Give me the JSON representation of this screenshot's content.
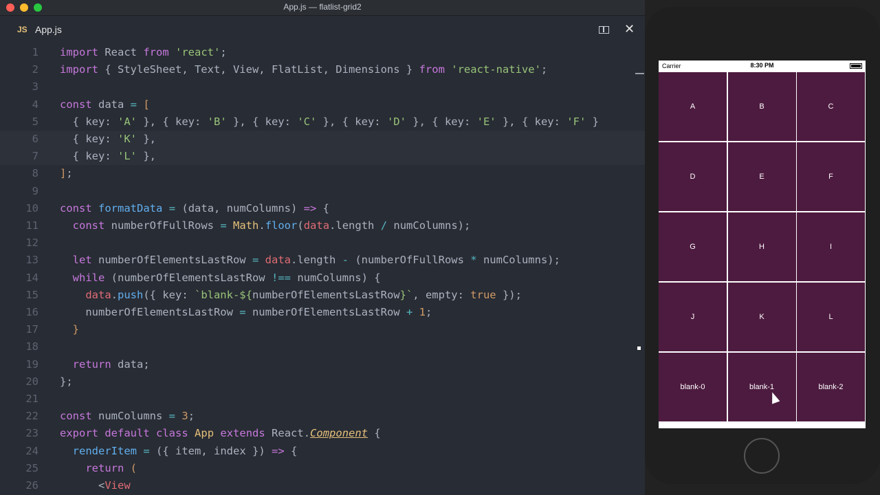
{
  "window_title": "App.js — flatlist-grid2",
  "tab": {
    "badge": "JS",
    "name": "App.js"
  },
  "code_lines": [
    {
      "n": "1",
      "html": "<span class='kw'>import</span> React <span class='kw'>from</span> <span class='str'>'react'</span>;"
    },
    {
      "n": "2",
      "html": "<span class='kw'>import</span> { StyleSheet, Text, View, FlatList, Dimensions } <span class='kw'>from</span> <span class='str'>'react-native'</span>;"
    },
    {
      "n": "3",
      "html": ""
    },
    {
      "n": "4",
      "html": "<span class='kw'>const</span> data <span class='op'>=</span> <span class='num'>[</span>"
    },
    {
      "n": "5",
      "html": "  { key: <span class='str'>'A'</span> }, { key: <span class='str'>'B'</span> }, { key: <span class='str'>'C'</span> }, { key: <span class='str'>'D'</span> }, { key: <span class='str'>'E'</span> }, { key: <span class='str'>'F'</span> }"
    },
    {
      "n": "6",
      "html": "  { key: <span class='str'>'K'</span> },"
    },
    {
      "n": "7",
      "html": "  { key: <span class='str'>'L'</span> },"
    },
    {
      "n": "8",
      "html": "<span class='num'>]</span>;"
    },
    {
      "n": "9",
      "html": ""
    },
    {
      "n": "10",
      "html": "<span class='kw'>const</span> <span class='fn'>formatData</span> <span class='op'>=</span> (data, numColumns) <span class='kw'>=&gt;</span> {"
    },
    {
      "n": "11",
      "html": "  <span class='kw'>const</span> numberOfFullRows <span class='op'>=</span> <span class='cls'>Math</span>.<span class='fn'>floor</span>(<span class='var'>data</span>.length <span class='op'>/</span> numColumns);"
    },
    {
      "n": "12",
      "html": ""
    },
    {
      "n": "13",
      "html": "  <span class='kw'>let</span> numberOfElementsLastRow <span class='op'>=</span> <span class='var'>data</span>.length <span class='op'>-</span> (numberOfFullRows <span class='op'>*</span> numColumns);"
    },
    {
      "n": "14",
      "html": "  <span class='kw'>while</span> (numberOfElementsLastRow <span class='op'>!==</span> numColumns) {"
    },
    {
      "n": "15",
      "html": "    <span class='var'>data</span>.<span class='fn'>push</span>({ key: <span class='str'>`blank-${</span>numberOfElementsLastRow<span class='str'>}`</span>, empty: <span class='num'>true</span> });"
    },
    {
      "n": "16",
      "html": "    numberOfElementsLastRow <span class='op'>=</span> numberOfElementsLastRow <span class='op'>+</span> <span class='num'>1</span>;"
    },
    {
      "n": "17",
      "html": "  <span class='num'>}</span>"
    },
    {
      "n": "18",
      "html": ""
    },
    {
      "n": "19",
      "html": "  <span class='kw'>return</span> data;"
    },
    {
      "n": "20",
      "html": "};"
    },
    {
      "n": "21",
      "html": ""
    },
    {
      "n": "22",
      "html": "<span class='kw'>const</span> numColumns <span class='op'>=</span> <span class='num'>3</span>;"
    },
    {
      "n": "23",
      "html": "<span class='kw'>export</span> <span class='kw'>default</span> <span class='kw'>class</span> <span class='cls'>App</span> <span class='kw'>extends</span> React.<span class='cls italic'>Component</span> {"
    },
    {
      "n": "24",
      "html": "  <span class='fn'>renderItem</span> <span class='op'>=</span> ({ item, index }) <span class='kw'>=&gt;</span> {"
    },
    {
      "n": "25",
      "html": "    <span class='kw'>return</span> <span class='num'>(</span>"
    },
    {
      "n": "26",
      "html": "      &lt;<span class='var'>View</span>"
    }
  ],
  "status": {
    "carrier": "Carrier",
    "time": "8:30 PM"
  },
  "grid": [
    "A",
    "B",
    "C",
    "D",
    "E",
    "F",
    "G",
    "H",
    "I",
    "J",
    "K",
    "L",
    "blank-0",
    "blank-1",
    "blank-2"
  ]
}
